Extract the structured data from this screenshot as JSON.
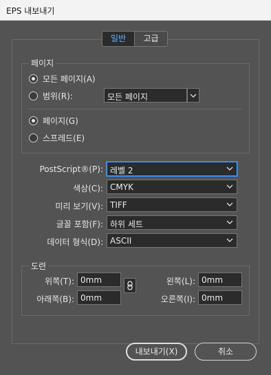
{
  "window": {
    "title": "EPS 내보내기"
  },
  "tabs": [
    {
      "label": "일반",
      "active": true
    },
    {
      "label": "고급",
      "active": false
    }
  ],
  "pages": {
    "group_label": "페이지",
    "all_pages_label": "모든 페이지(A)",
    "range_label": "범위(R):",
    "range_value": "모든 페이지",
    "pages_label": "페이지(G)",
    "spreads_label": "스프레드(E)"
  },
  "options": {
    "postscript_label": "PostScript®(P):",
    "postscript_value": "레벨 2",
    "color_label": "색상(C):",
    "color_value": "CMYK",
    "preview_label": "미리 보기(V):",
    "preview_value": "TIFF",
    "font_label": "글꼴 포함(F):",
    "font_value": "하위 세트",
    "data_label": "데이터 형식(D):",
    "data_value": "ASCII"
  },
  "bleed": {
    "group_label": "도련",
    "top_label": "위쪽(T):",
    "top_value": "0mm",
    "bottom_label": "아래쪽(B):",
    "bottom_value": "0mm",
    "left_label": "왼쪽(L):",
    "left_value": "0mm",
    "right_label": "오른쪽(I):",
    "right_value": "0mm"
  },
  "buttons": {
    "export_label": "내보내기(X)",
    "cancel_label": "취소"
  },
  "colors": {
    "accent": "#5cb4ff",
    "focus": "#4aa3ff",
    "panel": "#535353",
    "field": "#2b2b2b"
  }
}
